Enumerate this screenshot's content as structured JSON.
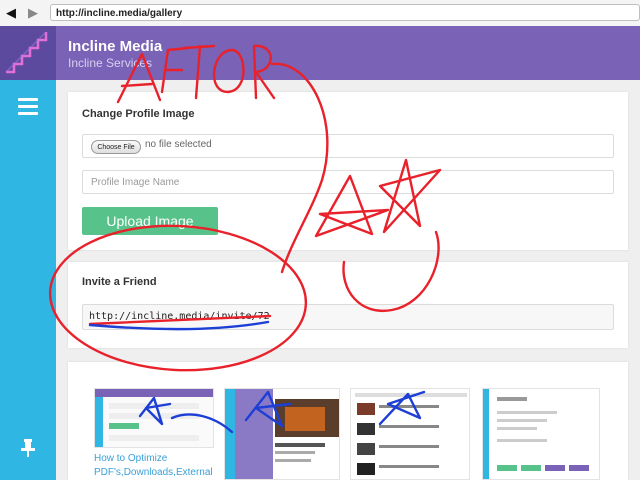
{
  "browser": {
    "back_icon": "back-arrow-icon",
    "forward_icon": "forward-arrow-icon",
    "url": "http://incline.media/gallery"
  },
  "header": {
    "title": "Incline Media",
    "subtitle": "Incline Services",
    "logo_icon": "stairs-logo-icon",
    "color": "#7a62b7"
  },
  "sidebar": {
    "menu_icon": "hamburger-icon",
    "pin_icon": "pin-icon",
    "color": "#2fb6e3"
  },
  "profile_card": {
    "title": "Change Profile Image",
    "choose_file_label": "Choose File",
    "file_status": "no file selected",
    "name_placeholder": "Profile Image Name",
    "upload_label": "Upload Image",
    "upload_color": "#57c28a"
  },
  "invite_card": {
    "title": "Invite a Friend",
    "invite_url": "http://incline.media/invite/72"
  },
  "gallery": {
    "first_caption": "How to Optimize PDF's,Downloads,External"
  },
  "annotations": {
    "handwritten_text": "AFTOR",
    "ink_colors": [
      "#e8212b",
      "#1d3fd6"
    ]
  }
}
